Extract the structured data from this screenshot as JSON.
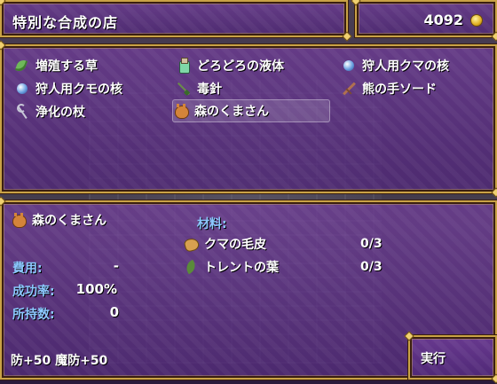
{
  "shop": {
    "title": "特別な合成の店"
  },
  "gold": {
    "amount": "4092",
    "icon": "coin-icon"
  },
  "recipes": [
    {
      "label": "増殖する草",
      "icon": "herb-icon"
    },
    {
      "label": "どろどろの液体",
      "icon": "bottle-icon"
    },
    {
      "label": "狩人用クマの核",
      "icon": "orb-icon"
    },
    {
      "label": "狩人用クモの核",
      "icon": "orb-icon"
    },
    {
      "label": "毒針",
      "icon": "needle-icon"
    },
    {
      "label": "熊の手ソード",
      "icon": "sword-icon"
    },
    {
      "label": "浄化の杖",
      "icon": "staff-icon"
    },
    {
      "label": "森のくまさん",
      "icon": "bear-icon",
      "selected": true
    }
  ],
  "detail": {
    "item_name": "森のくまさん",
    "cost_label": "費用:",
    "cost_value": "-",
    "success_label": "成功率:",
    "success_value": "100%",
    "owned_label": "所持数:",
    "owned_value": "0",
    "materials_label": "材料:",
    "materials": [
      {
        "name": "クマの毛皮",
        "count": "0/3",
        "icon": "fur-icon"
      },
      {
        "name": "トレントの葉",
        "count": "0/3",
        "icon": "leaf-icon"
      }
    ],
    "stats": "防+50 魔防+50"
  },
  "execute": {
    "label": "実行"
  },
  "colors": {
    "window": "#6e3c96",
    "border": "#c9a246",
    "label_blue": "#8cc8ff"
  }
}
